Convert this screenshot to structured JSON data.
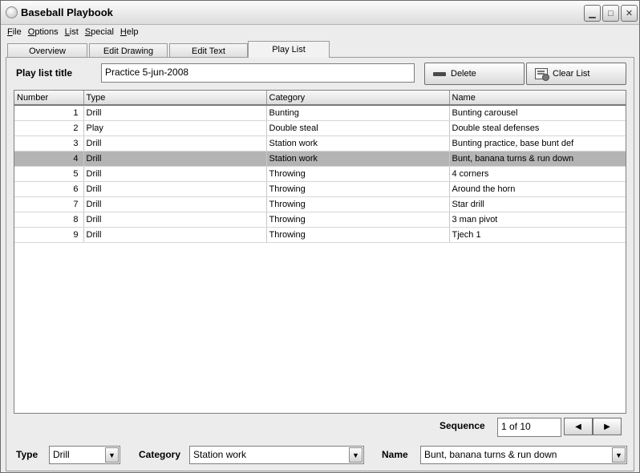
{
  "window": {
    "title": "Baseball Playbook"
  },
  "menu": [
    "File",
    "Options",
    "List",
    "Special",
    "Help"
  ],
  "tabs": [
    "Overview",
    "Edit Drawing",
    "Edit Text",
    "Play List"
  ],
  "active_tab": "Play List",
  "playlist": {
    "title_label": "Play list title",
    "title_value": "Practice 5-jun-2008",
    "delete_label": "Delete",
    "clear_label": "Clear List"
  },
  "table": {
    "columns": [
      "Number",
      "Type",
      "Category",
      "Name"
    ],
    "rows": [
      {
        "number": "1",
        "type": "Drill",
        "category": "Bunting",
        "name": "Bunting carousel"
      },
      {
        "number": "2",
        "type": "Play",
        "category": "Double steal",
        "name": "Double steal defenses"
      },
      {
        "number": "3",
        "type": "Drill",
        "category": "Station work",
        "name": "Bunting practice, base bunt def"
      },
      {
        "number": "4",
        "type": "Drill",
        "category": "Station work",
        "name": "Bunt, banana turns & run down"
      },
      {
        "number": "5",
        "type": "Drill",
        "category": "Throwing",
        "name": "4 corners"
      },
      {
        "number": "6",
        "type": "Drill",
        "category": "Throwing",
        "name": "Around the horn"
      },
      {
        "number": "7",
        "type": "Drill",
        "category": "Throwing",
        "name": "Star drill"
      },
      {
        "number": "8",
        "type": "Drill",
        "category": "Throwing",
        "name": "3 man pivot"
      },
      {
        "number": "9",
        "type": "Drill",
        "category": "Throwing",
        "name": "Tjech 1"
      }
    ],
    "selected_row": 4
  },
  "sequence": {
    "label": "Sequence",
    "value": "1 of 10",
    "prev_icon": "◀",
    "next_icon": "▶"
  },
  "filters": {
    "type_label": "Type",
    "type_value": "Drill",
    "category_label": "Category",
    "category_value": "Station work",
    "name_label": "Name",
    "name_value": "Bunt, banana turns & run down"
  },
  "colors": {
    "selected_row": "#b4b4b4",
    "window_bg": "#ececec"
  }
}
